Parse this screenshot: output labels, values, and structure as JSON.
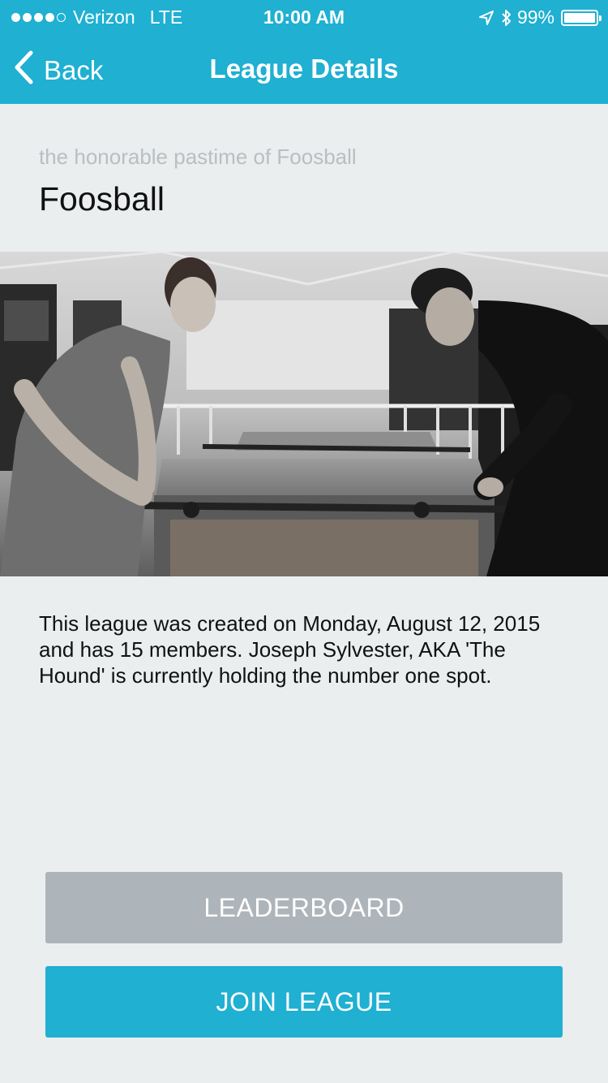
{
  "status_bar": {
    "carrier": "Verizon",
    "network": "LTE",
    "time": "10:00 AM",
    "battery_percent": "99%",
    "signal_strength": 4,
    "signal_max": 5,
    "battery_level": 0.99
  },
  "nav": {
    "back_label": "Back",
    "title": "League Details"
  },
  "league": {
    "subtitle": "the honorable pastime of Foosball",
    "name": "Foosball",
    "description": "This league was created on Monday, August 12, 2015 and has 15 members. Joseph Sylvester, AKA 'The Hound' is currently holding the number one spot."
  },
  "buttons": {
    "leaderboard": "LEADERBOARD",
    "join": "JOIN LEAGUE"
  },
  "colors": {
    "accent": "#1fb0d2",
    "background": "#ebeeef",
    "secondary_button": "#adb5ba"
  }
}
